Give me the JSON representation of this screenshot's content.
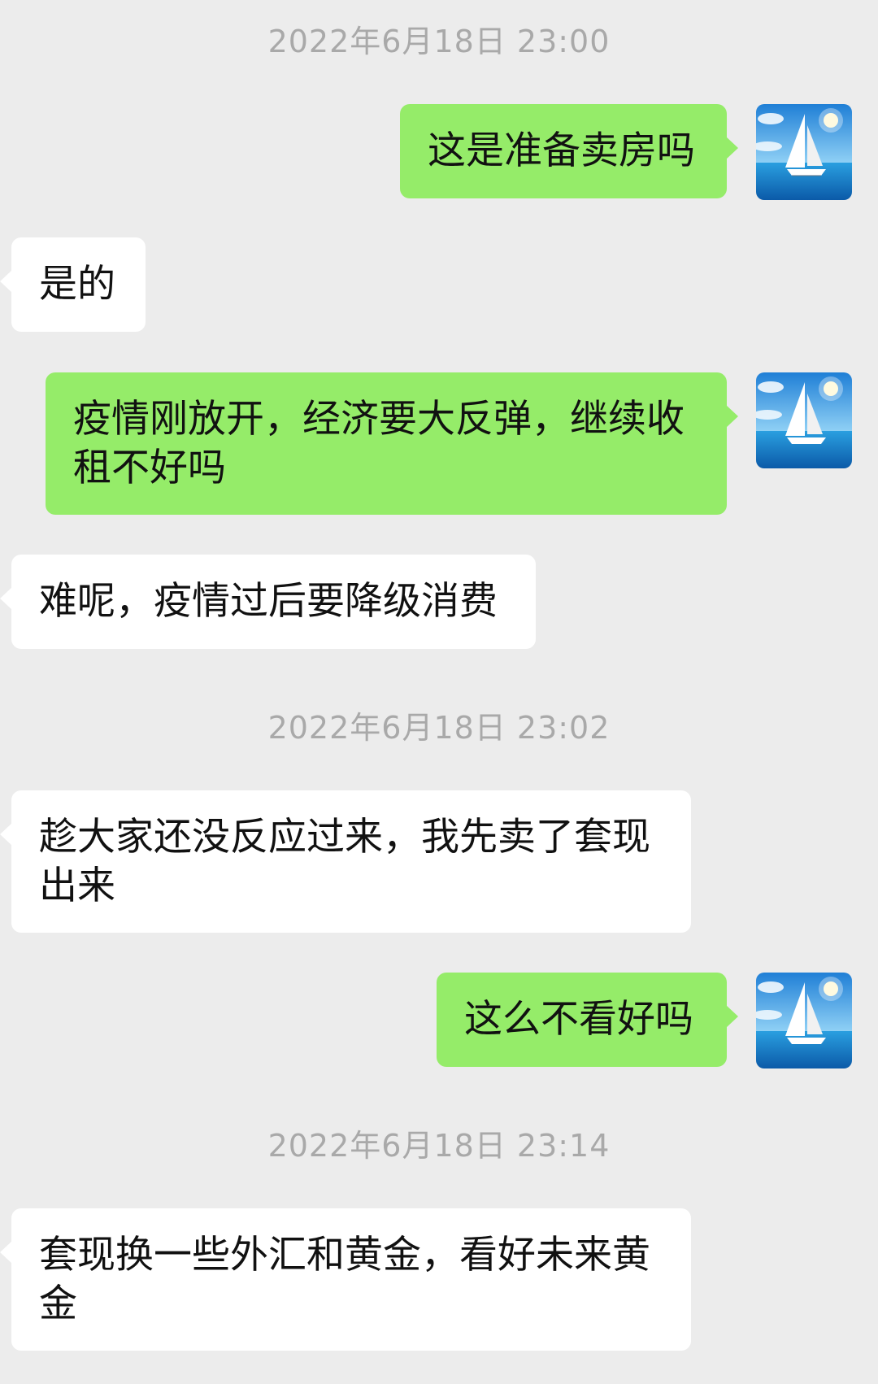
{
  "chat": {
    "timestamps": [
      "2022年6月18日 23:00",
      "2022年6月18日 23:02",
      "2022年6月18日 23:14"
    ],
    "messages": [
      {
        "side": "sent",
        "text": "这是准备卖房吗"
      },
      {
        "side": "received",
        "text": "是的"
      },
      {
        "side": "sent",
        "text": "疫情刚放开，经济要大反弹，继续收租不好吗"
      },
      {
        "side": "received",
        "text": "难呢，疫情过后要降级消费"
      },
      {
        "side": "received",
        "text": "趁大家还没反应过来，我先卖了套现出来"
      },
      {
        "side": "sent",
        "text": "这么不看好吗"
      },
      {
        "side": "received",
        "text": "套现换一些外汇和黄金，看好未来黄金"
      }
    ],
    "avatar_icon": "sailboat-icon"
  },
  "colors": {
    "background": "#ececec",
    "sent_bubble": "#95ec69",
    "received_bubble": "#ffffff",
    "timestamp_text": "#a9a9a9"
  }
}
